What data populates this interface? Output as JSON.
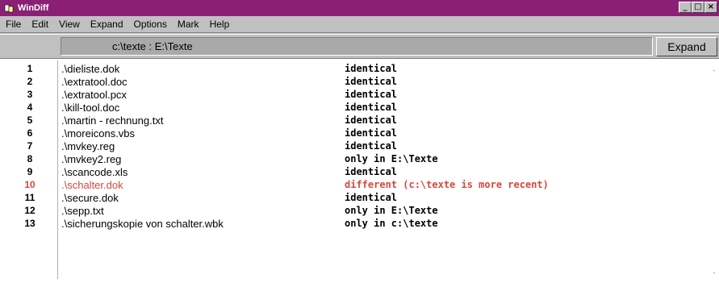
{
  "window": {
    "title": "WinDiff",
    "controls": {
      "minimize": "_",
      "maximize": "□",
      "close": "×"
    }
  },
  "menu": [
    "File",
    "Edit",
    "View",
    "Expand",
    "Options",
    "Mark",
    "Help"
  ],
  "toolbar": {
    "path": "c:\\texte : E:\\Texte",
    "expand_label": "Expand"
  },
  "rows": [
    {
      "num": "1",
      "file": ".\\dieliste.dok",
      "status": "identical"
    },
    {
      "num": "2",
      "file": ".\\extratool.doc",
      "status": "identical"
    },
    {
      "num": "3",
      "file": ".\\extratool.pcx",
      "status": "identical"
    },
    {
      "num": "4",
      "file": ".\\kill-tool.doc",
      "status": "identical"
    },
    {
      "num": "5",
      "file": ".\\martin - rechnung.txt",
      "status": "identical"
    },
    {
      "num": "6",
      "file": ".\\moreicons.vbs",
      "status": "identical"
    },
    {
      "num": "7",
      "file": ".\\mvkey.reg",
      "status": "identical"
    },
    {
      "num": "8",
      "file": ".\\mvkey2.reg",
      "status": "only in E:\\Texte"
    },
    {
      "num": "9",
      "file": ".\\scancode.xls",
      "status": "identical"
    },
    {
      "num": "10",
      "file": ".\\schalter.dok",
      "status": "different (c:\\texte is more recent)",
      "highlight": true
    },
    {
      "num": "11",
      "file": ".\\secure.dok",
      "status": "identical"
    },
    {
      "num": "12",
      "file": ".\\sepp.txt",
      "status": "only in E:\\Texte"
    },
    {
      "num": "13",
      "file": ".\\sicherungskopie von schalter.wbk",
      "status": "only in c:\\texte"
    }
  ],
  "colors": {
    "titlebar": "#8a1f73",
    "highlight": "#d6473d"
  }
}
